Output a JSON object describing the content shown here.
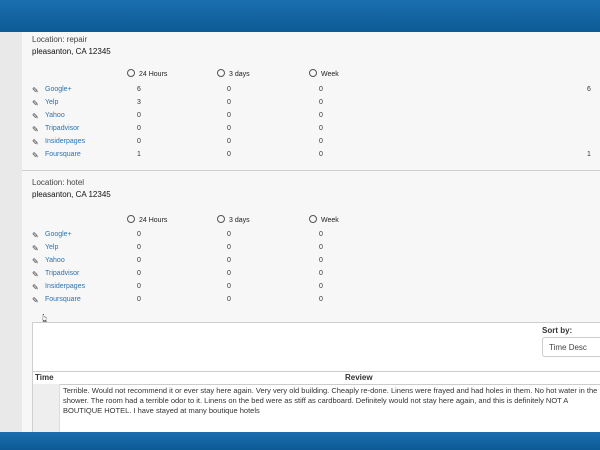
{
  "locations": [
    {
      "title": "Location: repair",
      "address": "pleasanton, CA 12345",
      "headers": [
        "24 Hours",
        "3 days",
        "Week"
      ],
      "rows": [
        {
          "site": "Google+",
          "h24": "6",
          "d3": "0",
          "week": "0",
          "right": "6"
        },
        {
          "site": "Yelp",
          "h24": "3",
          "d3": "0",
          "week": "0",
          "right": ""
        },
        {
          "site": "Yahoo",
          "h24": "0",
          "d3": "0",
          "week": "0",
          "right": ""
        },
        {
          "site": "Tripadvisor",
          "h24": "0",
          "d3": "0",
          "week": "0",
          "right": ""
        },
        {
          "site": "Insiderpages",
          "h24": "0",
          "d3": "0",
          "week": "0",
          "right": ""
        },
        {
          "site": "Foursquare",
          "h24": "1",
          "d3": "0",
          "week": "0",
          "right": "1"
        }
      ]
    },
    {
      "title": "Location: hotel",
      "address": "pleasanton, CA 12345",
      "headers": [
        "24 Hours",
        "3 days",
        "Week"
      ],
      "rows": [
        {
          "site": "Google+",
          "h24": "0",
          "d3": "0",
          "week": "0"
        },
        {
          "site": "Yelp",
          "h24": "0",
          "d3": "0",
          "week": "0"
        },
        {
          "site": "Yahoo",
          "h24": "0",
          "d3": "0",
          "week": "0"
        },
        {
          "site": "Tripadvisor",
          "h24": "0",
          "d3": "0",
          "week": "0"
        },
        {
          "site": "Insiderpages",
          "h24": "0",
          "d3": "0",
          "week": "0"
        },
        {
          "site": "Foursquare",
          "h24": "0",
          "d3": "0",
          "week": "0"
        }
      ]
    }
  ],
  "reviews_panel": {
    "sort_label": "Sort by:",
    "sort_value": "Time Desc",
    "col_time": "Time",
    "col_review": "Review",
    "review_text": "Terrible. Would not recommend it or ever stay here again. Very very old building. Cheaply re-done. Linens were frayed and had holes in them. No hot water in the shower. The room had a terrible odor to it. Linens on the bed were as stiff as cardboard. Definitely would not stay here again, and this is definitely NOT A BOUTIQUE HOTEL. I have stayed at many boutique hotels"
  },
  "icons": {
    "edit": "pencil-icon",
    "time": "clock-icon",
    "cursor": "mouse-cursor-icon"
  },
  "colors": {
    "header_bar": "#1a6fae",
    "link": "#2a73b5"
  }
}
